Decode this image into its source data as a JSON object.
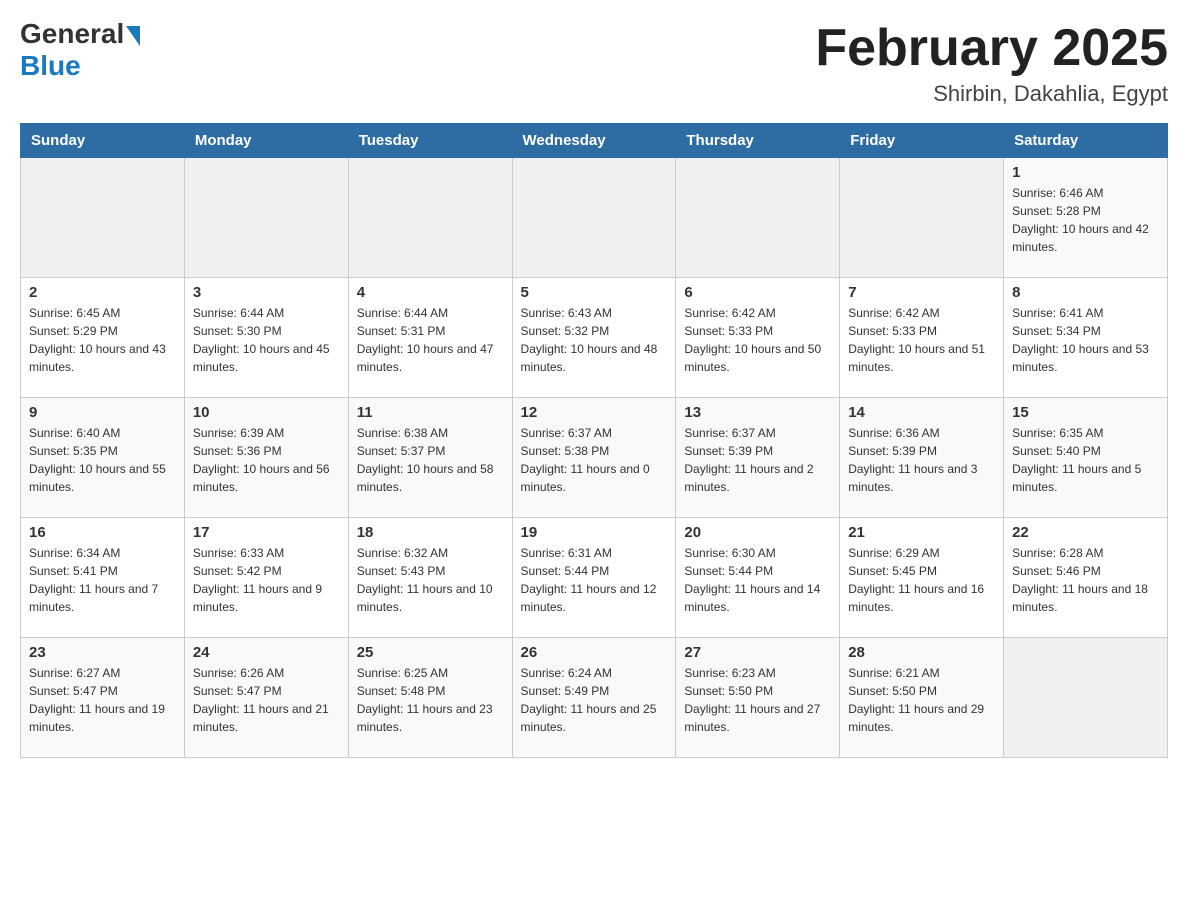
{
  "header": {
    "logo_general": "General",
    "logo_blue": "Blue",
    "month_title": "February 2025",
    "location": "Shirbin, Dakahlia, Egypt"
  },
  "days_of_week": [
    "Sunday",
    "Monday",
    "Tuesday",
    "Wednesday",
    "Thursday",
    "Friday",
    "Saturday"
  ],
  "weeks": [
    [
      {
        "num": "",
        "sunrise": "",
        "sunset": "",
        "daylight": ""
      },
      {
        "num": "",
        "sunrise": "",
        "sunset": "",
        "daylight": ""
      },
      {
        "num": "",
        "sunrise": "",
        "sunset": "",
        "daylight": ""
      },
      {
        "num": "",
        "sunrise": "",
        "sunset": "",
        "daylight": ""
      },
      {
        "num": "",
        "sunrise": "",
        "sunset": "",
        "daylight": ""
      },
      {
        "num": "",
        "sunrise": "",
        "sunset": "",
        "daylight": ""
      },
      {
        "num": "1",
        "sunrise": "Sunrise: 6:46 AM",
        "sunset": "Sunset: 5:28 PM",
        "daylight": "Daylight: 10 hours and 42 minutes."
      }
    ],
    [
      {
        "num": "2",
        "sunrise": "Sunrise: 6:45 AM",
        "sunset": "Sunset: 5:29 PM",
        "daylight": "Daylight: 10 hours and 43 minutes."
      },
      {
        "num": "3",
        "sunrise": "Sunrise: 6:44 AM",
        "sunset": "Sunset: 5:30 PM",
        "daylight": "Daylight: 10 hours and 45 minutes."
      },
      {
        "num": "4",
        "sunrise": "Sunrise: 6:44 AM",
        "sunset": "Sunset: 5:31 PM",
        "daylight": "Daylight: 10 hours and 47 minutes."
      },
      {
        "num": "5",
        "sunrise": "Sunrise: 6:43 AM",
        "sunset": "Sunset: 5:32 PM",
        "daylight": "Daylight: 10 hours and 48 minutes."
      },
      {
        "num": "6",
        "sunrise": "Sunrise: 6:42 AM",
        "sunset": "Sunset: 5:33 PM",
        "daylight": "Daylight: 10 hours and 50 minutes."
      },
      {
        "num": "7",
        "sunrise": "Sunrise: 6:42 AM",
        "sunset": "Sunset: 5:33 PM",
        "daylight": "Daylight: 10 hours and 51 minutes."
      },
      {
        "num": "8",
        "sunrise": "Sunrise: 6:41 AM",
        "sunset": "Sunset: 5:34 PM",
        "daylight": "Daylight: 10 hours and 53 minutes."
      }
    ],
    [
      {
        "num": "9",
        "sunrise": "Sunrise: 6:40 AM",
        "sunset": "Sunset: 5:35 PM",
        "daylight": "Daylight: 10 hours and 55 minutes."
      },
      {
        "num": "10",
        "sunrise": "Sunrise: 6:39 AM",
        "sunset": "Sunset: 5:36 PM",
        "daylight": "Daylight: 10 hours and 56 minutes."
      },
      {
        "num": "11",
        "sunrise": "Sunrise: 6:38 AM",
        "sunset": "Sunset: 5:37 PM",
        "daylight": "Daylight: 10 hours and 58 minutes."
      },
      {
        "num": "12",
        "sunrise": "Sunrise: 6:37 AM",
        "sunset": "Sunset: 5:38 PM",
        "daylight": "Daylight: 11 hours and 0 minutes."
      },
      {
        "num": "13",
        "sunrise": "Sunrise: 6:37 AM",
        "sunset": "Sunset: 5:39 PM",
        "daylight": "Daylight: 11 hours and 2 minutes."
      },
      {
        "num": "14",
        "sunrise": "Sunrise: 6:36 AM",
        "sunset": "Sunset: 5:39 PM",
        "daylight": "Daylight: 11 hours and 3 minutes."
      },
      {
        "num": "15",
        "sunrise": "Sunrise: 6:35 AM",
        "sunset": "Sunset: 5:40 PM",
        "daylight": "Daylight: 11 hours and 5 minutes."
      }
    ],
    [
      {
        "num": "16",
        "sunrise": "Sunrise: 6:34 AM",
        "sunset": "Sunset: 5:41 PM",
        "daylight": "Daylight: 11 hours and 7 minutes."
      },
      {
        "num": "17",
        "sunrise": "Sunrise: 6:33 AM",
        "sunset": "Sunset: 5:42 PM",
        "daylight": "Daylight: 11 hours and 9 minutes."
      },
      {
        "num": "18",
        "sunrise": "Sunrise: 6:32 AM",
        "sunset": "Sunset: 5:43 PM",
        "daylight": "Daylight: 11 hours and 10 minutes."
      },
      {
        "num": "19",
        "sunrise": "Sunrise: 6:31 AM",
        "sunset": "Sunset: 5:44 PM",
        "daylight": "Daylight: 11 hours and 12 minutes."
      },
      {
        "num": "20",
        "sunrise": "Sunrise: 6:30 AM",
        "sunset": "Sunset: 5:44 PM",
        "daylight": "Daylight: 11 hours and 14 minutes."
      },
      {
        "num": "21",
        "sunrise": "Sunrise: 6:29 AM",
        "sunset": "Sunset: 5:45 PM",
        "daylight": "Daylight: 11 hours and 16 minutes."
      },
      {
        "num": "22",
        "sunrise": "Sunrise: 6:28 AM",
        "sunset": "Sunset: 5:46 PM",
        "daylight": "Daylight: 11 hours and 18 minutes."
      }
    ],
    [
      {
        "num": "23",
        "sunrise": "Sunrise: 6:27 AM",
        "sunset": "Sunset: 5:47 PM",
        "daylight": "Daylight: 11 hours and 19 minutes."
      },
      {
        "num": "24",
        "sunrise": "Sunrise: 6:26 AM",
        "sunset": "Sunset: 5:47 PM",
        "daylight": "Daylight: 11 hours and 21 minutes."
      },
      {
        "num": "25",
        "sunrise": "Sunrise: 6:25 AM",
        "sunset": "Sunset: 5:48 PM",
        "daylight": "Daylight: 11 hours and 23 minutes."
      },
      {
        "num": "26",
        "sunrise": "Sunrise: 6:24 AM",
        "sunset": "Sunset: 5:49 PM",
        "daylight": "Daylight: 11 hours and 25 minutes."
      },
      {
        "num": "27",
        "sunrise": "Sunrise: 6:23 AM",
        "sunset": "Sunset: 5:50 PM",
        "daylight": "Daylight: 11 hours and 27 minutes."
      },
      {
        "num": "28",
        "sunrise": "Sunrise: 6:21 AM",
        "sunset": "Sunset: 5:50 PM",
        "daylight": "Daylight: 11 hours and 29 minutes."
      },
      {
        "num": "",
        "sunrise": "",
        "sunset": "",
        "daylight": ""
      }
    ]
  ]
}
